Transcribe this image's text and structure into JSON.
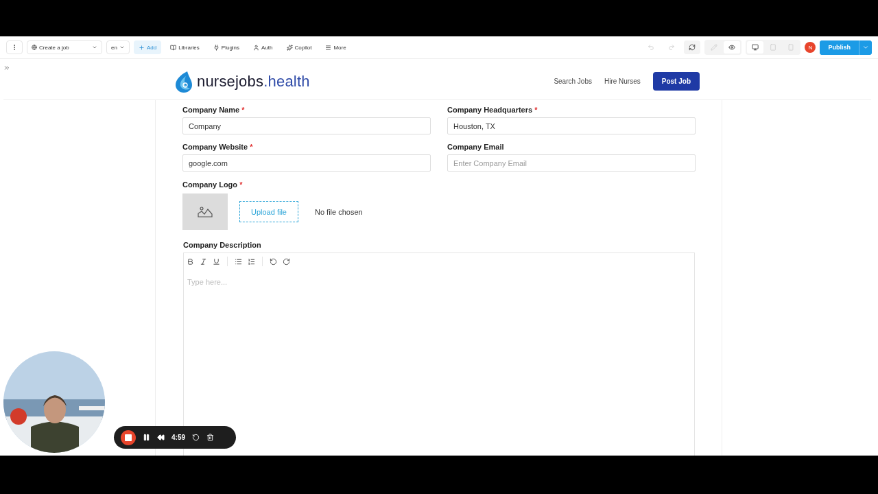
{
  "toolbar": {
    "page_select": "Create a job",
    "language": "en",
    "add": "Add",
    "items": [
      {
        "kind": "book",
        "label": "Libraries"
      },
      {
        "kind": "plug",
        "label": "Plugins"
      },
      {
        "kind": "user",
        "label": "Auth"
      },
      {
        "kind": "sparkle",
        "label": "Copilot"
      },
      {
        "kind": "menu",
        "label": "More"
      }
    ],
    "view_modes": [
      {
        "kind": "edit",
        "selected": false
      },
      {
        "kind": "preview",
        "selected": true
      }
    ],
    "devices": [
      {
        "kind": "desktop",
        "selected": true
      },
      {
        "kind": "tablet",
        "selected": false
      },
      {
        "kind": "mobile",
        "selected": false
      }
    ],
    "avatar": "N",
    "publish": "Publish"
  },
  "header": {
    "logo": {
      "text": "nursejobs",
      "accent": ".health"
    },
    "links": [
      "Search Jobs",
      "Hire Nurses"
    ],
    "cta": "Post Job"
  },
  "form": {
    "required_mark": "*",
    "fields": [
      {
        "label": "Company Name",
        "required": true,
        "value": "Company"
      },
      {
        "label": "Company Headquarters",
        "required": true,
        "value": "Houston, TX"
      },
      {
        "label": "Company Website",
        "required": true,
        "value": "google.com"
      },
      {
        "label": "Company Email",
        "required": false,
        "placeholder": "Enter Company Email"
      }
    ],
    "logo": {
      "label": "Company Logo",
      "required": true,
      "button": "Upload file",
      "status": "No file chosen"
    },
    "description": {
      "label": "Company Description",
      "placeholder": "Type here..."
    }
  },
  "recorder": {
    "time": "4:59"
  }
}
